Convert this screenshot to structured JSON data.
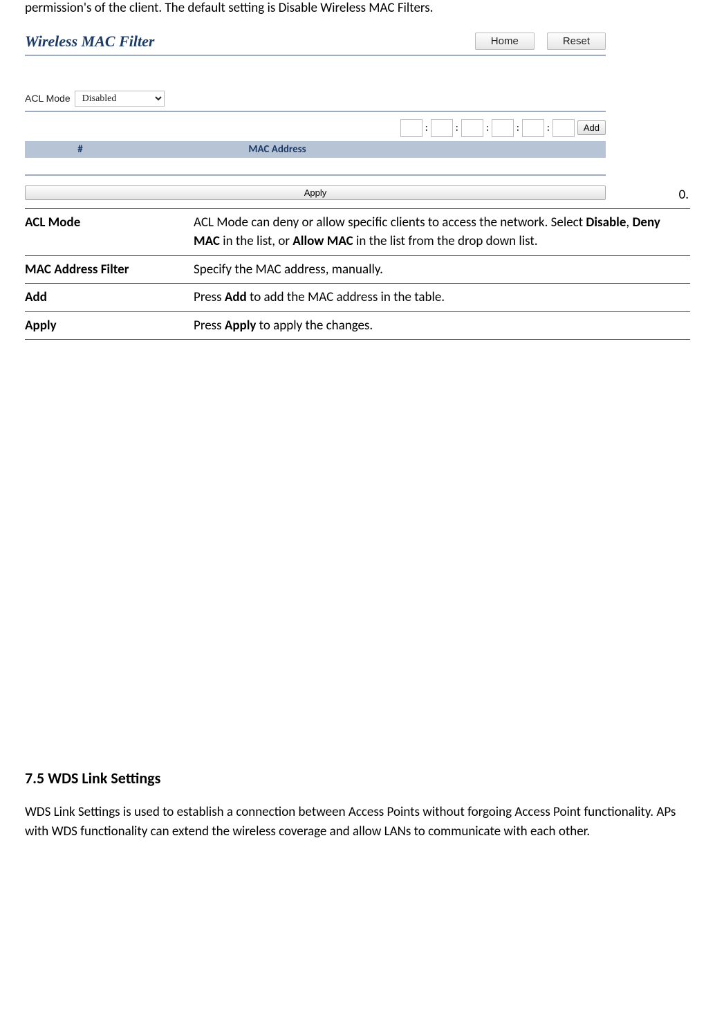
{
  "intro": "permission's of the client. The default setting is Disable Wireless MAC Filters.",
  "screenshot": {
    "title": "Wireless MAC Filter",
    "home_btn": "Home",
    "reset_btn": "Reset",
    "acl_label": "ACL Mode",
    "acl_value": "Disabled",
    "add_btn": "Add",
    "col_num": "#",
    "col_mac": "MAC Address",
    "apply_btn": "Apply"
  },
  "trailing_marker": "0.",
  "rows": [
    {
      "key": "ACL Mode",
      "parts": [
        {
          "t": "ACL Mode can deny or allow specific clients to access the network. Select ",
          "b": false
        },
        {
          "t": "Disable",
          "b": true
        },
        {
          "t": ", ",
          "b": false
        },
        {
          "t": "Deny MAC",
          "b": true
        },
        {
          "t": " in the list, or ",
          "b": false
        },
        {
          "t": "Allow MAC",
          "b": true
        },
        {
          "t": " in the list from the drop down list.",
          "b": false
        }
      ]
    },
    {
      "key": "MAC Address Filter",
      "parts": [
        {
          "t": "Specify the MAC address, manually.",
          "b": false
        }
      ]
    },
    {
      "key": "Add",
      "parts": [
        {
          "t": "Press ",
          "b": false
        },
        {
          "t": "Add",
          "b": true
        },
        {
          "t": " to add the MAC address in the table.",
          "b": false
        }
      ]
    },
    {
      "key": "Apply",
      "parts": [
        {
          "t": "Press ",
          "b": false
        },
        {
          "t": "Apply",
          "b": true
        },
        {
          "t": " to apply the changes.",
          "b": false
        }
      ]
    }
  ],
  "section": {
    "heading": "7.5 WDS Link Settings",
    "body": "WDS Link Settings is used to establish a connection between Access Points without forgoing Access Point functionality. APs with WDS functionality can extend the wireless coverage and allow LANs to communicate with each other."
  }
}
